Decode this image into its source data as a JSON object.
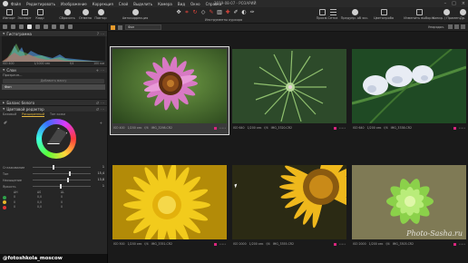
{
  "menubar": {
    "items": [
      "Файл",
      "Редактировать",
      "Изображение",
      "Коррекция",
      "Слой",
      "Выделить",
      "Камера",
      "Вид",
      "Окно",
      "Справка"
    ],
    "window_title": "2019-08-07 - РОЗАРИЙ"
  },
  "toolbar": {
    "import": "Импорт",
    "export": "Экспорт",
    "edit": "Кадр",
    "reset": "Сбросить",
    "undo": "Отмена",
    "redo": "Повтор",
    "autocorrect": "Автокоррекция",
    "cursor_tools": "Инструменты курсора",
    "viewer": "Просм.",
    "grid": "Сетка",
    "proof": "Предупр. об экс.",
    "proofing": "Цветопроба",
    "change_selection": "Изменить выбор в",
    "copy_apply": "Копир. / Примен.",
    "help": "Др.",
    "edit2": "Ра"
  },
  "left": {
    "histogram": {
      "title": "Гистограмма",
      "iso": "ISO 400",
      "shutter": "1/1000 сек",
      "aperture": "f/4",
      "focal": "100 мм"
    },
    "layers": {
      "title": "Слои",
      "opacity_label": "Прозрачн...",
      "add_mask": "Добавить маску",
      "background_layer": "Фон"
    },
    "white_balance": {
      "title": "Баланс белого"
    },
    "color_editor": {
      "title": "Цветовой редактор",
      "tabs": [
        "Базовый",
        "Расширенный",
        "Тон кожи"
      ],
      "active_tab": "Расширенный",
      "sliders": [
        {
          "label": "Сглаживание",
          "value": "1"
        },
        {
          "label": "Тон",
          "value": "15,4"
        },
        {
          "label": "Насыщение",
          "value": "13,8"
        },
        {
          "label": "Яркость",
          "value": "1"
        }
      ],
      "table_head": [
        "ΔH",
        "ΔS",
        "ΔL"
      ],
      "table_rows": [
        {
          "color": "#2ea04a",
          "h": "0",
          "s": "0,0",
          "l": "0"
        },
        {
          "color": "#e8b92a",
          "h": "0",
          "s": "0,0",
          "l": "0"
        },
        {
          "color": "#e03535",
          "h": "0",
          "s": "0,0",
          "l": "0"
        }
      ],
      "convert": "Преобразовать с цветовой"
    },
    "watermark": "@fotoshkola_moscow"
  },
  "browser": {
    "album": "Фон",
    "sort": "Упорядоч.",
    "watermark": "Photo-Sasha.ru",
    "thumbs": [
      {
        "iso": "ISO 400",
        "shutter": "1/200 сек",
        "aperture": "f/4",
        "file": "IMG_3298.CR2",
        "selected": true
      },
      {
        "iso": "ISO 640",
        "shutter": "1/200 сек",
        "aperture": "f/4",
        "file": "IMG_3320.CR2",
        "selected": false
      },
      {
        "iso": "ISO 640",
        "shutter": "1/200 сек",
        "aperture": "f/4",
        "file": "IMG_3338.CR2",
        "selected": false
      },
      {
        "iso": "ISO 500",
        "shutter": "1/200 сек",
        "aperture": "f/4",
        "file": "IMG_3351.CR2",
        "selected": false
      },
      {
        "iso": "ISO 2000",
        "shutter": "1/200 сек",
        "aperture": "f/4",
        "file": "IMG_3355.CR2",
        "selected": false
      },
      {
        "iso": "ISO 2000",
        "shutter": "1/200 сек",
        "aperture": "f/4",
        "file": "IMG_3303.CR2",
        "selected": false
      }
    ]
  }
}
